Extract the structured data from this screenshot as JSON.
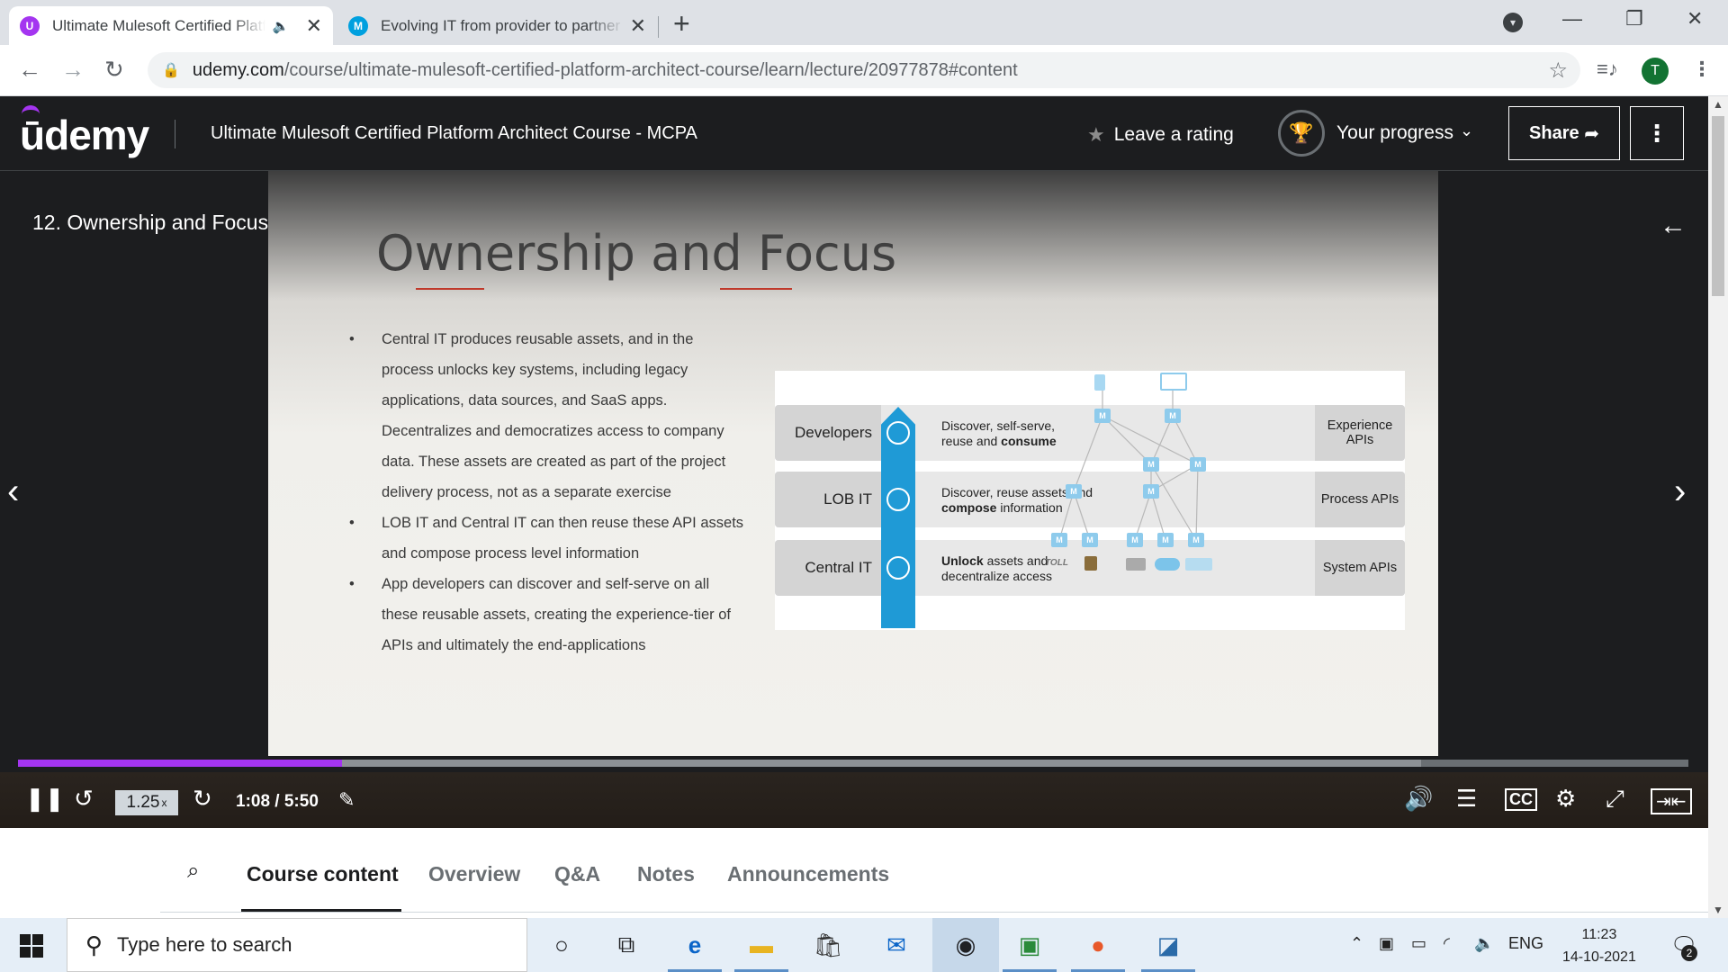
{
  "browser": {
    "tabs": [
      {
        "title": "Ultimate Mulesoft Certified Platform Architect Course - MCPA",
        "favicon": "U",
        "active": true
      },
      {
        "title": "Evolving IT from provider to partner",
        "favicon": "M",
        "active": false
      }
    ],
    "url_domain": "udemy.com",
    "url_path": "/course/ultimate-mulesoft-certified-platform-architect-course/learn/lecture/20977878#content",
    "profile_initial": "T"
  },
  "udemy": {
    "logo": "ūdemy",
    "course_title": "Ultimate Mulesoft Certified Platform Architect Course - MCPA",
    "leave_rating": "Leave a rating",
    "your_progress": "Your progress",
    "share": "Share",
    "brand_color": "#a435f0"
  },
  "video": {
    "lecture_title": "12. Ownership and Focus",
    "playback_rate": "1.25",
    "playback_rate_suffix": "x",
    "time": "1:08 / 5:50",
    "played_fraction": 0.194,
    "buffered_fraction": 0.84,
    "slide": {
      "title": "Ownership and Focus",
      "bullets": [
        "Central IT produces reusable assets, and in the process unlocks key systems, including legacy applications, data sources, and SaaS apps. Decentralizes and democratizes access to company data. These assets are created as part of the project delivery process, not as a separate exercise",
        "LOB IT and Central IT can then reuse these API assets and compose process level information",
        "App developers can discover and self-serve on all these reusable assets, creating the experience-tier of APIs and ultimately the end-applications"
      ],
      "diagram": {
        "rows": [
          {
            "actor": "Developers",
            "desc_plain": "Discover, self-serve,",
            "desc_line2_plain": "reuse and ",
            "desc_line2_bold": "consume",
            "tier": "Experience APIs"
          },
          {
            "actor": "LOB IT",
            "desc_plain": "Discover, reuse assets and",
            "desc_line2_bold": "compose",
            "desc_line2_plain": " information",
            "tier": "Process APIs"
          },
          {
            "actor": "Central IT",
            "desc_bold": "Unlock",
            "desc_plain": " assets and",
            "desc_line2_plain": "decentralize access",
            "tier": "System APIs"
          }
        ],
        "system_logos": [
          "TOLL"
        ]
      }
    }
  },
  "lecture_tabs": [
    "Course content",
    "Overview",
    "Q&A",
    "Notes",
    "Announcements"
  ],
  "taskbar": {
    "search_placeholder": "Type here to search",
    "language": "ENG",
    "time": "11:23",
    "date": "14-10-2021",
    "notification_count": "2"
  }
}
